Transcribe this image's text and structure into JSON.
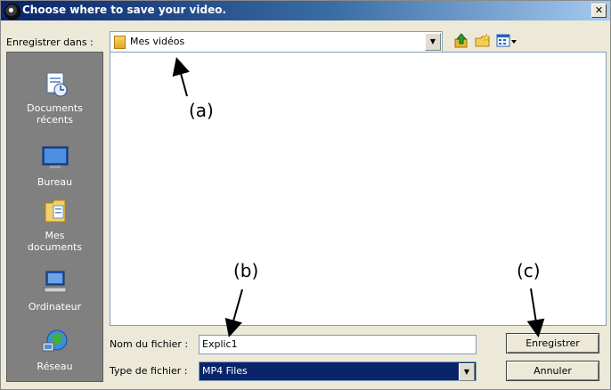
{
  "window": {
    "title": "Choose where to save your video.",
    "close_glyph": "✕"
  },
  "toolbar": {
    "save_in_label": "Enregistrer dans :",
    "location_value": "Mes vidéos",
    "icons": [
      "folder-up-icon",
      "new-folder-icon",
      "view-menu-icon"
    ]
  },
  "places": [
    {
      "label": "Documents\nrécents",
      "icon": "recent-documents-icon"
    },
    {
      "label": "Bureau",
      "icon": "desktop-icon"
    },
    {
      "label": "Mes\ndocuments",
      "icon": "my-documents-icon"
    },
    {
      "label": "Ordinateur",
      "icon": "computer-icon"
    },
    {
      "label": "Réseau",
      "icon": "network-icon"
    }
  ],
  "form": {
    "filename_label": "Nom du fichier :",
    "filename_value": "Explic1",
    "filetype_label": "Type de fichier :",
    "filetype_value": "MP4 Files"
  },
  "buttons": {
    "save": "Enregistrer",
    "cancel": "Annuler"
  },
  "annotations": {
    "a": "(a)",
    "b": "(b)",
    "c": "(c)"
  }
}
